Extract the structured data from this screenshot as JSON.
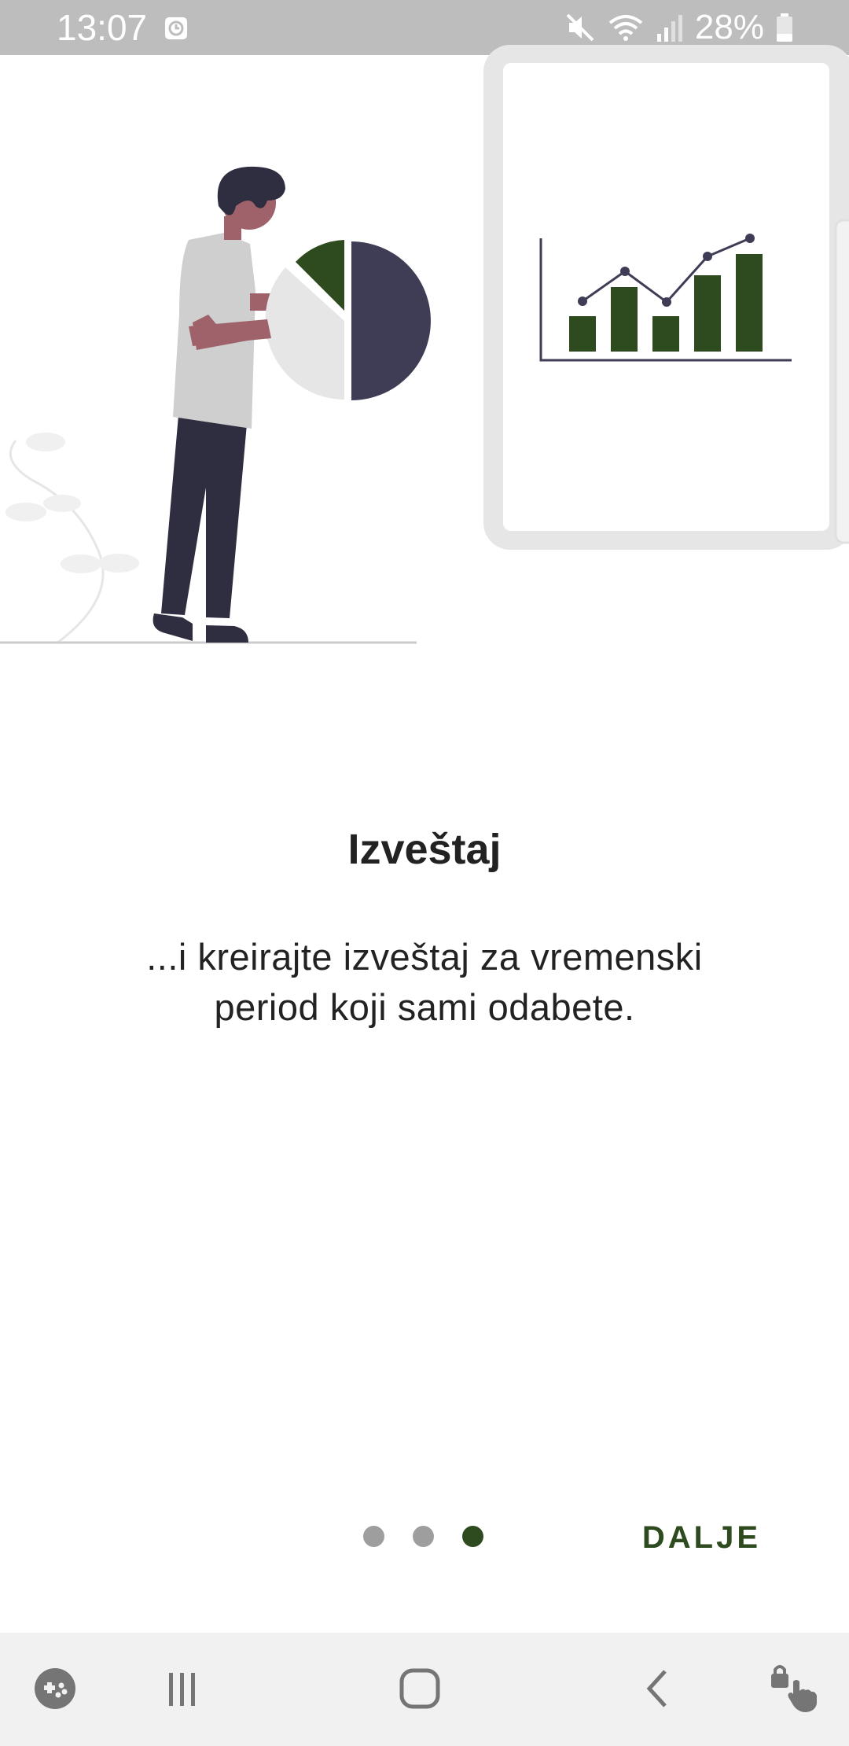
{
  "status_bar": {
    "time": "13:07",
    "battery": "28%",
    "icons": [
      "alarm-icon",
      "mute-icon",
      "wifi-icon",
      "signal-icon",
      "battery-icon"
    ]
  },
  "onboarding": {
    "title": "Izveštaj",
    "description": "...i kreirajte izveštaj za vremenski period koji sami odabete.",
    "page_count": 3,
    "active_page": 3,
    "next_label": "DALJE"
  },
  "nav_bar": {
    "icons": [
      "game-launcher-icon",
      "recent-apps-icon",
      "home-icon",
      "back-icon",
      "screen-pin-icon"
    ]
  },
  "colors": {
    "accent": "#2e4a1f",
    "status_bar": "#bdbdbd",
    "nav_bar": "#f1f1f1",
    "dot_inactive": "#9e9e9e",
    "dark_figure": "#3f3d56",
    "skin": "#9f616a"
  }
}
